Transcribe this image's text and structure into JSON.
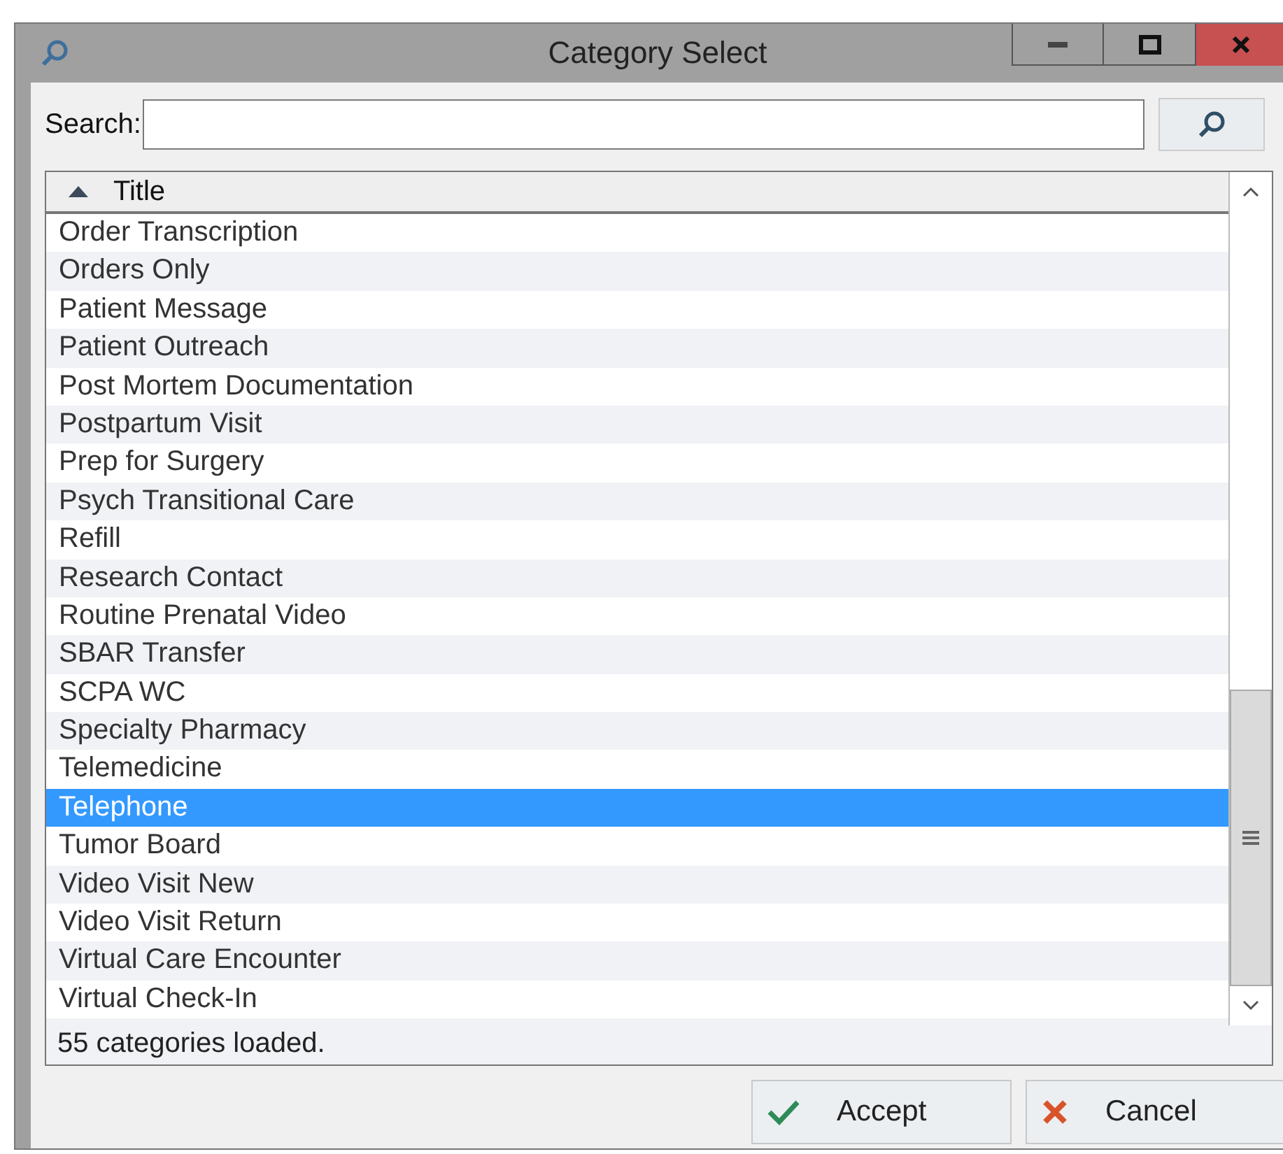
{
  "window": {
    "title": "Category Select"
  },
  "search": {
    "label": "Search:"
  },
  "table": {
    "columns": [
      {
        "label": "Title",
        "sorted_ascending": true
      }
    ],
    "rows": [
      {
        "title": "Order Transcription",
        "selected": false
      },
      {
        "title": "Orders Only",
        "selected": false
      },
      {
        "title": "Patient Message",
        "selected": false
      },
      {
        "title": "Patient Outreach",
        "selected": false
      },
      {
        "title": "Post Mortem Documentation",
        "selected": false
      },
      {
        "title": "Postpartum Visit",
        "selected": false
      },
      {
        "title": "Prep for Surgery",
        "selected": false
      },
      {
        "title": "Psych Transitional Care",
        "selected": false
      },
      {
        "title": "Refill",
        "selected": false
      },
      {
        "title": "Research Contact",
        "selected": false
      },
      {
        "title": "Routine Prenatal Video",
        "selected": false
      },
      {
        "title": "SBAR Transfer",
        "selected": false
      },
      {
        "title": "SCPA WC",
        "selected": false
      },
      {
        "title": "Specialty Pharmacy",
        "selected": false
      },
      {
        "title": "Telemedicine",
        "selected": false
      },
      {
        "title": "Telephone",
        "selected": true
      },
      {
        "title": "Tumor Board",
        "selected": false
      },
      {
        "title": "Video Visit New",
        "selected": false
      },
      {
        "title": "Video Visit Return",
        "selected": false
      },
      {
        "title": "Virtual Care Encounter",
        "selected": false
      },
      {
        "title": "Virtual Check-In",
        "selected": false
      }
    ]
  },
  "status_bar": "55 categories loaded.",
  "buttons": [
    {
      "label": "Accept",
      "kind": "accept"
    },
    {
      "label": "Cancel",
      "kind": "cancel"
    }
  ]
}
